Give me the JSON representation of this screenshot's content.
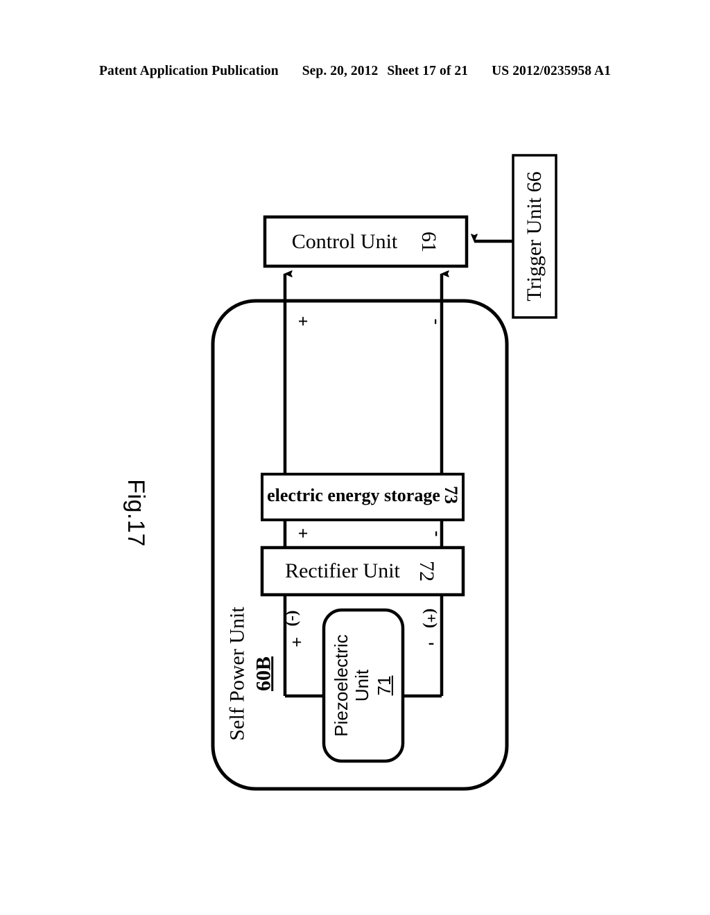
{
  "header": {
    "publication": "Patent Application Publication",
    "date": "Sep. 20, 2012",
    "sheet": "Sheet 17 of 21",
    "doc_number": "US 2012/0235958 A1"
  },
  "figure": {
    "title": "Fig.17",
    "enclosure": {
      "name": "Self Power Unit",
      "ref": "60B"
    },
    "blocks": [
      {
        "id": "control",
        "label": "Control Unit",
        "ref": "61",
        "style": "serif"
      },
      {
        "id": "trigger",
        "label": "Trigger Unit 66",
        "ref": "",
        "style": "serif"
      },
      {
        "id": "storage",
        "label": "electric energy storage",
        "ref": "73",
        "style": "serif-bold"
      },
      {
        "id": "rectifier",
        "label": "Rectifier Unit",
        "ref": "72",
        "style": "serif"
      },
      {
        "id": "piezo",
        "label_line1": "Piezoelectric",
        "label_line2": "Unit",
        "ref": "71",
        "style": "sans"
      }
    ],
    "signals": {
      "control_plus": "+",
      "control_minus": "-",
      "storage_plus": "+",
      "storage_minus": "-",
      "rect_in_left_paren": "(-)",
      "rect_in_left_sign": "+",
      "rect_in_right_paren": "(+)",
      "rect_in_right_sign": "-"
    }
  },
  "colors": {
    "ink": "#000000",
    "paper": "#ffffff"
  }
}
